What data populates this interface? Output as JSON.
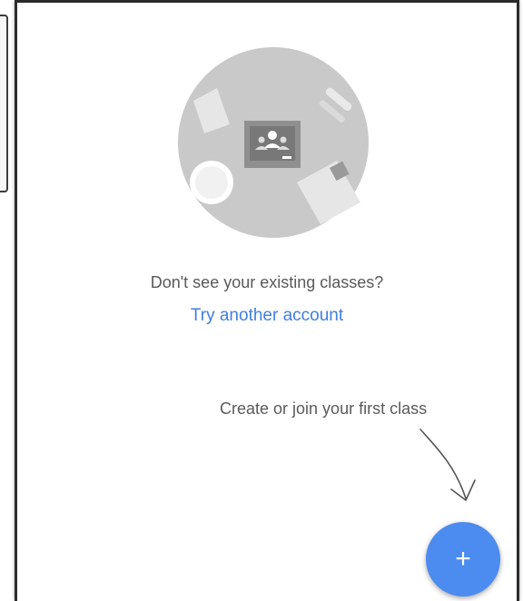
{
  "empty_state": {
    "illustration_icon": "classroom-table-icon",
    "prompt": "Don't see your existing classes?",
    "account_link": "Try another account"
  },
  "hint": {
    "text": "Create or join your first class",
    "arrow_icon": "hand-drawn-arrow-icon"
  },
  "fab": {
    "label": "+",
    "icon": "plus-icon"
  },
  "colors": {
    "link": "#3f7fe0",
    "fab": "#4c8cf0",
    "illustration": "#c8c8c8"
  }
}
